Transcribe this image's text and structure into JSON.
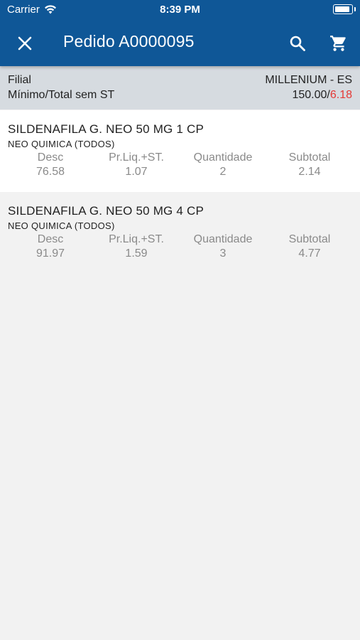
{
  "status_bar": {
    "carrier": "Carrier",
    "time": "8:39 PM"
  },
  "header": {
    "title": "Pedido A0000095",
    "icons": [
      "close-icon",
      "search-icon",
      "cart-icon"
    ],
    "background": "#0f5797"
  },
  "summary": {
    "filial_label": "Filial",
    "filial_value": "MILLENIUM - ES",
    "minimo_label": "Mínimo/Total sem ST",
    "minimo_value": "150.00",
    "separator": "/",
    "total_value": "6.18",
    "total_color": "#e53935"
  },
  "columns": {
    "desc": "Desc",
    "price": "Pr.Liq.+ST.",
    "qty": "Quantidade",
    "subtotal": "Subtotal"
  },
  "items": [
    {
      "name": "SILDENAFILA G. NEO 50 MG 1 CP",
      "brand": "NEO QUIMICA (TODOS)",
      "desc": "76.58",
      "price": "1.07",
      "qty": "2",
      "subtotal": "2.14"
    },
    {
      "name": "SILDENAFILA G. NEO 50 MG 4 CP",
      "brand": "NEO QUIMICA (TODOS)",
      "desc": "91.97",
      "price": "1.59",
      "qty": "3",
      "subtotal": "4.77"
    }
  ]
}
